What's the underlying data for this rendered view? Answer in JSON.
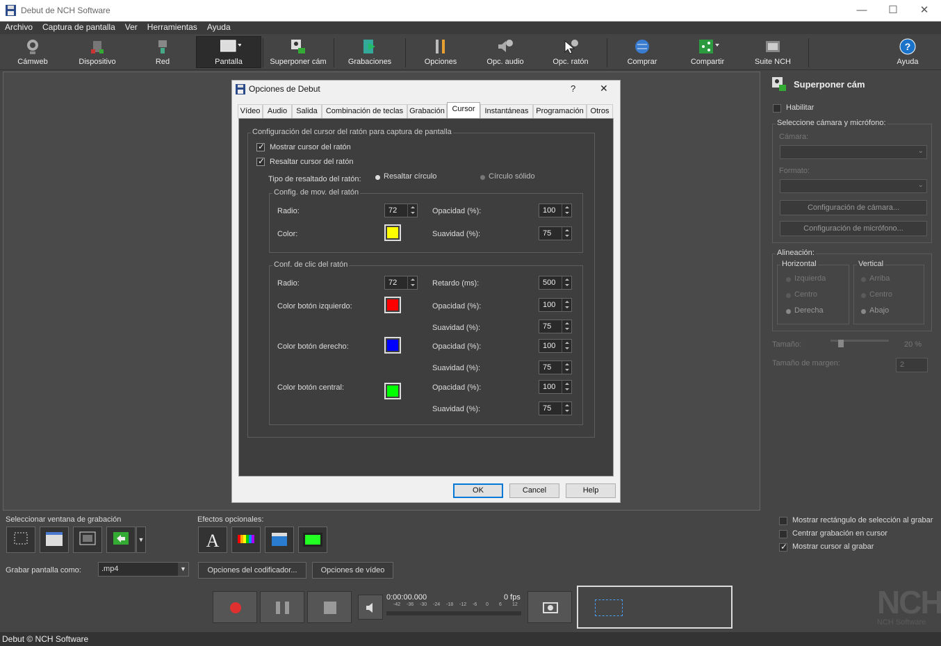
{
  "window": {
    "title": "Debut de NCH Software",
    "min": "—",
    "max": "☐",
    "close": "✕"
  },
  "menu": [
    "Archivo",
    "Captura de pantalla",
    "Ver",
    "Herramientas",
    "Ayuda"
  ],
  "toolbar": {
    "camweb": "Cámweb",
    "dispositivo": "Dispositivo",
    "red": "Red",
    "pantalla": "Pantalla",
    "superponer": "Superponer cám",
    "grabaciones": "Grabaciones",
    "opciones": "Opciones",
    "opc_audio": "Opc. audio",
    "opc_raton": "Opc. ratón",
    "comprar": "Comprar",
    "compartir": "Compartir",
    "suite": "Suite NCH",
    "ayuda": "Ayuda"
  },
  "dialog": {
    "title": "Opciones de Debut",
    "help": "?",
    "close": "✕",
    "tabs": [
      "Vídeo",
      "Audio",
      "Salida",
      "Combinación de teclas",
      "Grabación",
      "Cursor",
      "Instantáneas",
      "Programación",
      "Otros"
    ],
    "selected_tab": "Cursor",
    "group_main": "Configuración del cursor del ratón para captura de pantalla",
    "show_cursor": "Mostrar cursor del ratón",
    "highlight_cursor": "Resaltar cursor del ratón",
    "highlight_type_label": "Tipo de resaltado del ratón:",
    "radio_circle": "Resaltar círculo",
    "radio_solid": "Círculo sólido",
    "move_group": "Config. de mov. del ratón",
    "move": {
      "radio_label": "Radio:",
      "radio_value": "72",
      "opacity_label": "Opacidad (%):",
      "opacity_value": "100",
      "color_label": "Color:",
      "color": "#ffff00",
      "smooth_label": "Suavidad (%):",
      "smooth_value": "75"
    },
    "click_group": "Conf. de clic del ratón",
    "click": {
      "radio_label": "Radio:",
      "radio_value": "72",
      "delay_label": "Retardo (ms):",
      "delay_value": "500",
      "left_label": "Color botón izquierdo:",
      "left_color": "#ff0000",
      "left_opacity_label": "Opacidad (%):",
      "left_opacity": "100",
      "left_smooth_label": "Suavidad (%):",
      "left_smooth": "75",
      "right_label": "Color botón derecho:",
      "right_color": "#0000ff",
      "right_opacity_label": "Opacidad (%):",
      "right_opacity": "100",
      "right_smooth_label": "Suavidad (%):",
      "right_smooth": "75",
      "middle_label": "Color botón central:",
      "middle_color": "#00ff00",
      "middle_opacity_label": "Opacidad (%):",
      "middle_opacity": "100",
      "middle_smooth_label": "Suavidad (%):",
      "middle_smooth": "75"
    },
    "ok": "OK",
    "cancel": "Cancel",
    "help_btn": "Help"
  },
  "right_panel": {
    "title": "Superponer cám",
    "enable": "Habilitar",
    "select_group": "Seleccione cámara y micrófono:",
    "camera_label": "Cámara:",
    "format_label": "Formato:",
    "camera_config": "Configuración de cámara...",
    "mic_config": "Configuración de micrófono...",
    "align_group": "Alineación:",
    "horizontal": "Horizontal",
    "h_left": "Izquierda",
    "h_center": "Centro",
    "h_right": "Derecha",
    "vertical": "Vertical",
    "v_top": "Arriba",
    "v_center": "Centro",
    "v_bottom": "Abajo",
    "size_label": "Tamaño:",
    "size_value": "20 %",
    "size_level": 0.2,
    "margin_label": "Tamaño de margen:",
    "margin_value": "2"
  },
  "bottom": {
    "select_window": "Seleccionar ventana de grabación",
    "effects": "Efectos opcionales:",
    "record_as": "Grabar pantalla como:",
    "format": ".mp4",
    "encoder_options": "Opciones del codificador...",
    "video_options": "Opciones de vídeo",
    "show_rect": "Mostrar rectángulo de selección al grabar",
    "center_cursor": "Centrar grabación en cursor",
    "show_cursor": "Mostrar cursor al grabar",
    "time": "0:00:00.000",
    "fps": "0 fps",
    "meter_ticks": [
      "-42",
      "-36",
      "-30",
      "-24",
      "-18",
      "-12",
      "-6",
      "0",
      "6",
      "12"
    ],
    "nch": "NCH",
    "nch_sub": "NCH Software"
  },
  "status": "Debut © NCH Software"
}
